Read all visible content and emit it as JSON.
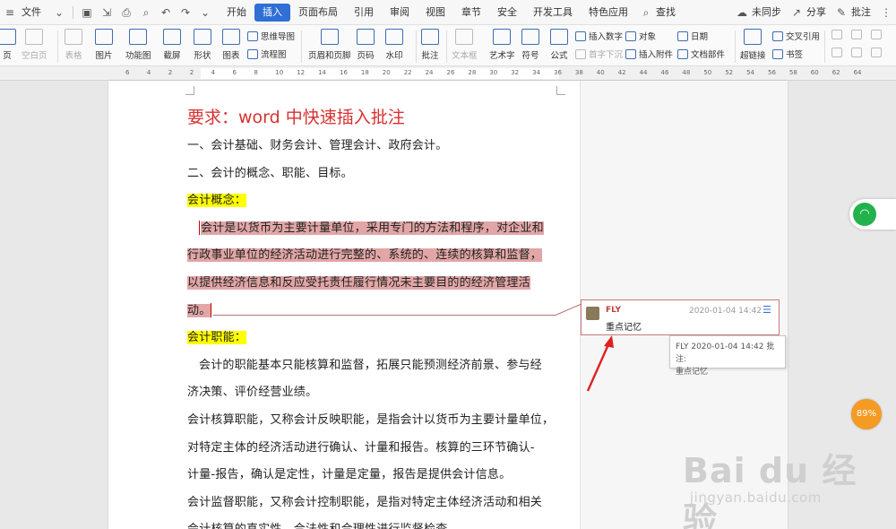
{
  "menubar": {
    "file": "文件",
    "tabs": [
      "开始",
      "插入",
      "页面布局",
      "引用",
      "审阅",
      "视图",
      "章节",
      "安全",
      "开发工具",
      "特色应用"
    ],
    "active_tab": "插入",
    "search": "查找",
    "sync": "未同步",
    "share": "分享",
    "comment": "批注"
  },
  "ribbon": {
    "page": "页",
    "blank_page": "空白页",
    "table": "表格",
    "image": "图片",
    "functional_chart": "功能图",
    "screenshot": "截屏",
    "shape": "形状",
    "chart": "图表",
    "mindmap": "思维导图",
    "flowchart": "流程图",
    "header_footer": "页眉和页脚",
    "page_number": "页码",
    "watermark": "水印",
    "comment": "批注",
    "textbox": "文本框",
    "art_text": "艺术字",
    "symbol": "符号",
    "formula": "公式",
    "insert_number": "插入数字",
    "object": "对象",
    "date": "日期",
    "drop_cap": "首字下沉",
    "insert_attachment": "插入附件",
    "doc_part": "文档部件",
    "hyperlink": "超链接",
    "cross_ref": "交叉引用",
    "bookmark": "书签"
  },
  "ruler": [
    "6",
    "4",
    "2",
    "2",
    "4",
    "6",
    "8",
    "10",
    "12",
    "14",
    "16",
    "18",
    "20",
    "22",
    "24",
    "26",
    "28",
    "30",
    "32",
    "34",
    "36",
    "38",
    "40",
    "42",
    "44",
    "46",
    "48",
    "50",
    "52",
    "54",
    "56",
    "58",
    "60",
    "62",
    "64"
  ],
  "document": {
    "title": "要求：word 中快速插入批注",
    "line1": "一、会计基础、财务会计、管理会计、政府会计。",
    "line2": "二、会计的概念、职能、目标。",
    "h_concept": "会计概念：",
    "p1_l1": "会计是以货币为主要计量单位，采用专门的方法和程序，对企业和",
    "p1_l2": "行政事业单位的经济活动进行完整的、系统的、连续的核算和监督，",
    "p1_l3": "以提供经济信息和反应受托责任履行情况未主要目的的经济管理活",
    "p1_l4": "动。",
    "h_function": "会计职能：",
    "p2_l1": "会计的职能基本只能核算和监督，拓展只能预测经济前景、参与经",
    "p2_l2": "济决策、评价经营业绩。",
    "p3_l1": "会计核算职能，又称会计反映职能，是指会计以货币为主要计量单位，",
    "p3_l2": "对特定主体的经济活动进行确认、计量和报告。核算的三环节确认-",
    "p3_l3": "计量-报告，确认是定性，计量是定量，报告是提供会计信息。",
    "p4_l1": "会计监督职能，又称会计控制职能，是指对特定主体经济活动和相关",
    "p4_l2": "会计核算的真实性、合法性和合理性进行监督检查"
  },
  "comment": {
    "author": "FLY",
    "time": "2020-01-04 14:42",
    "text": "重点记忆"
  },
  "tooltip": {
    "line1": "FLY 2020-01-04 14:42 批注:",
    "line2": "重点记忆"
  },
  "widgets": {
    "speed": "89%"
  },
  "watermark": {
    "big": "Bai du 经验",
    "small": "jingyan.baidu.com"
  },
  "colors": {
    "accent": "#2f6fd6",
    "title_red": "#d83131",
    "highlight_yellow": "#ffff00",
    "highlight_pink": "#e2a6a6",
    "arrow_red": "#e02020"
  }
}
